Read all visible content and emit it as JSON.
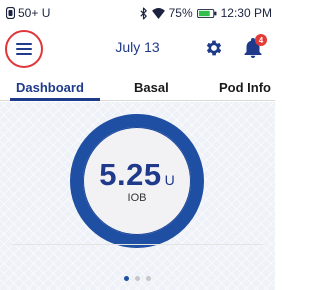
{
  "status_bar": {
    "pod_label": "50+ U",
    "battery_percent": "75%",
    "time": "12:30 PM"
  },
  "header": {
    "date": "July 13",
    "notification_count": "4"
  },
  "tabs": [
    {
      "label": "Dashboard",
      "active": true
    },
    {
      "label": "Basal",
      "active": false
    },
    {
      "label": "Pod Info",
      "active": false
    }
  ],
  "iob": {
    "value": "5.25",
    "unit": "U",
    "label": "IOB"
  },
  "pager": {
    "page_count": 3,
    "active_index": 0
  },
  "colors": {
    "brand_blue": "#1f4fa3",
    "highlight_red": "#e0363a",
    "badge_red": "#e53935",
    "battery_green": "#2fbf4a"
  },
  "icons": {
    "menu": "hamburger-menu-icon",
    "settings": "gear-icon",
    "notifications": "bell-icon",
    "bluetooth": "bluetooth-icon",
    "wifi": "wifi-icon",
    "battery": "battery-icon"
  }
}
